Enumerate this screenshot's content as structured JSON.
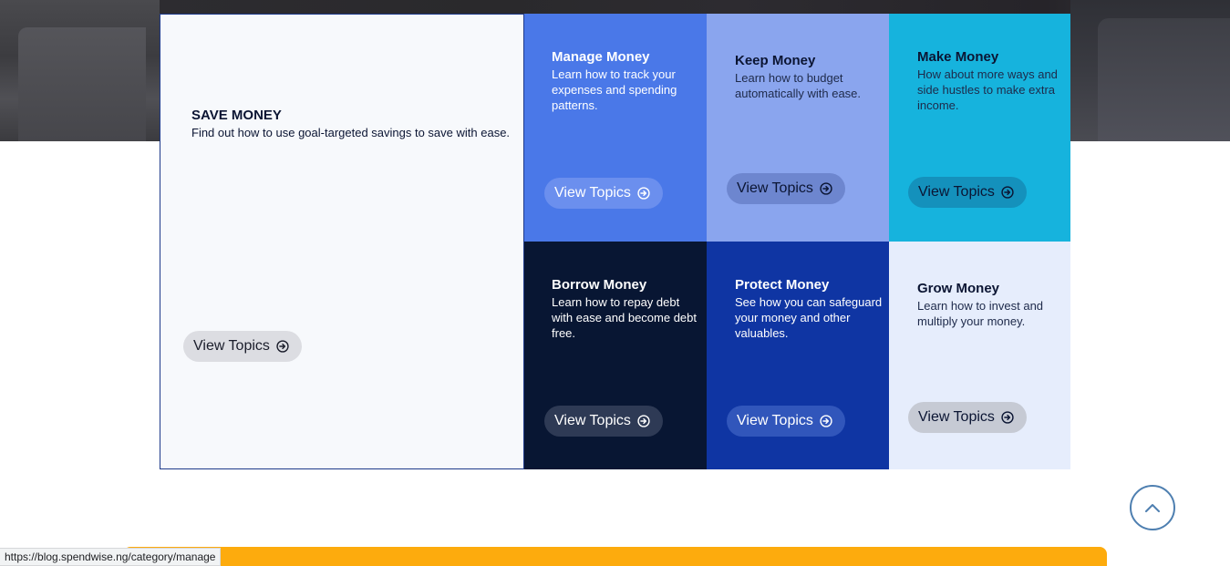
{
  "tiles": {
    "save": {
      "title": "SAVE MONEY",
      "description": "Find out how to use goal-targeted savings to save with ease.",
      "button": "View Topics",
      "color": "#f7f9fc"
    },
    "manage": {
      "title": "Manage Money",
      "description": "Learn how to track your expenses and spending patterns.",
      "button": "View Topics",
      "color": "#4a78e8"
    },
    "keep": {
      "title": "Keep Money",
      "description": "Learn how to budget automatically with ease.",
      "button": "View Topics",
      "color": "#8aa5ee"
    },
    "make": {
      "title": "Make Money",
      "description": "How about more ways and side hustles to make extra income.",
      "button": "View Topics",
      "color": "#16b3dd"
    },
    "borrow": {
      "title": "Borrow Money",
      "description": "Learn how to repay debt with ease and become debt free.",
      "button": "View Topics",
      "color": "#081633"
    },
    "protect": {
      "title": "Protect Money",
      "description": "See how you can safeguard your money and other valuables.",
      "button": "View Topics",
      "color": "#0f35a3"
    },
    "grow": {
      "title": "Grow Money",
      "description": "Learn how to invest and multiply your money.",
      "button": "View Topics",
      "color": "#e6edfc"
    }
  },
  "icons": {
    "button_icon": "arrow-right-circle-icon",
    "scroll_top_icon": "chevron-up-icon"
  },
  "status_bar": {
    "url": "https://blog.spendwise.ng/category/manage"
  },
  "colors": {
    "footer_accent": "#fdab0d",
    "scroll_top_border": "#4e7fb0"
  }
}
